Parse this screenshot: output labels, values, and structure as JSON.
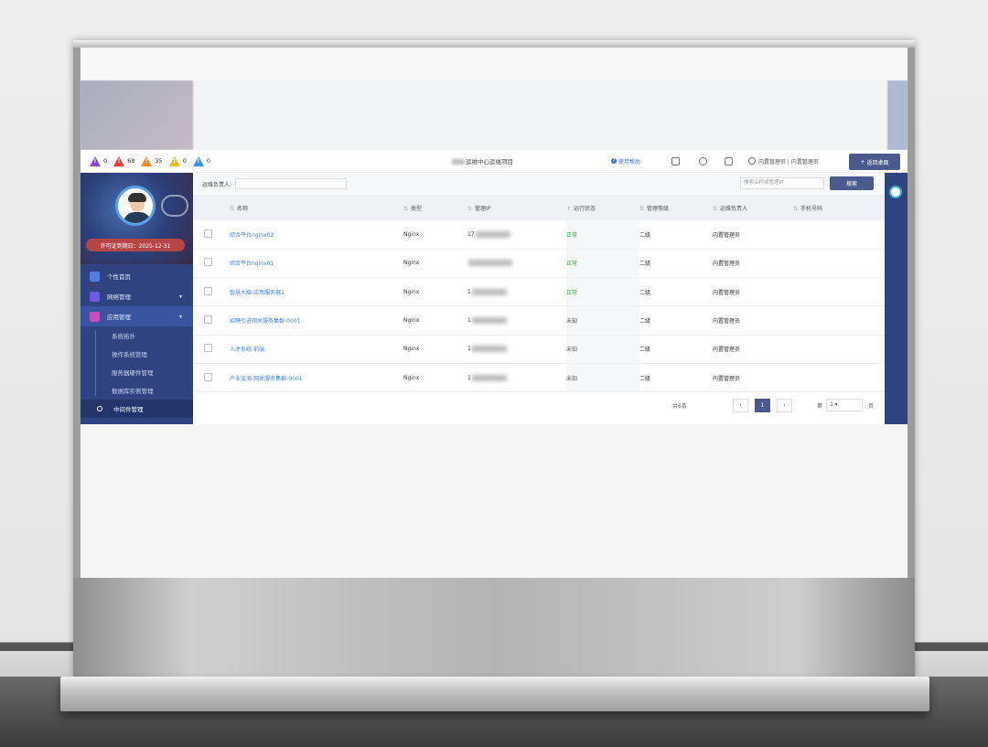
{
  "alerts": [
    {
      "color": "#8e44c8",
      "count": "0"
    },
    {
      "color": "#e23b3b",
      "count": "68"
    },
    {
      "color": "#f08a24",
      "count": "35"
    },
    {
      "color": "#e8c020",
      "count": "0"
    },
    {
      "color": "#3b8ee0",
      "count": "0"
    }
  ],
  "header": {
    "title_suffix": "运维中心运维项目",
    "help": "使用帮助",
    "user": "内置管理员 | 内置管理员",
    "back_button": "返回桌面"
  },
  "sidebar": {
    "expire": "许可证到期日：2025-12-31",
    "items": [
      {
        "label": "个性首页",
        "icon": "home-icon"
      },
      {
        "label": "网络管理",
        "icon": "network-icon"
      },
      {
        "label": "应用管理",
        "icon": "app-icon"
      }
    ],
    "subitems": [
      "系统拓扑",
      "操作系统管理",
      "服务器硬件管理",
      "数据库实例管理"
    ],
    "current": "中间件管理"
  },
  "filter": {
    "label": "运维负责人:",
    "search_placeholder": "搜索名称或管理IP",
    "search_button": "搜索"
  },
  "table": {
    "headers": [
      "名称",
      "类型",
      "管理IP",
      "运行状态",
      "管理等级",
      "运维负责人",
      "手机号码"
    ],
    "rows": [
      {
        "name": "综合平台nginx02",
        "type": "Nginx",
        "ip": "17",
        "status": "正常",
        "level": "二级",
        "owner": "内置管理员"
      },
      {
        "name": "综合平台nginx01",
        "type": "Nginx",
        "ip": "",
        "status": "正常",
        "level": "二级",
        "owner": "内置管理员"
      },
      {
        "name": "智慧大脑-应用服务器1",
        "type": "Nginx",
        "ip": "1",
        "status": "正常",
        "level": "二级",
        "owner": "内置管理员"
      },
      {
        "name": "招聘引进网关服务集群-0001",
        "type": "Nginx",
        "ip": "1",
        "status": "未知",
        "level": "二级",
        "owner": "内置管理员"
      },
      {
        "name": "人才系统-前端",
        "type": "Nginx",
        "ip": "1",
        "status": "未知",
        "level": "二级",
        "owner": "内置管理员"
      },
      {
        "name": "产业监测-网关服务集群-0001",
        "type": "Nginx",
        "ip": "1",
        "status": "未知",
        "level": "二级",
        "owner": "内置管理员"
      }
    ]
  },
  "pager": {
    "total": "共6条",
    "prev": "‹",
    "page": "1",
    "next": "›",
    "goto_prefix": "第",
    "goto_value": "1",
    "goto_suffix": "页"
  }
}
